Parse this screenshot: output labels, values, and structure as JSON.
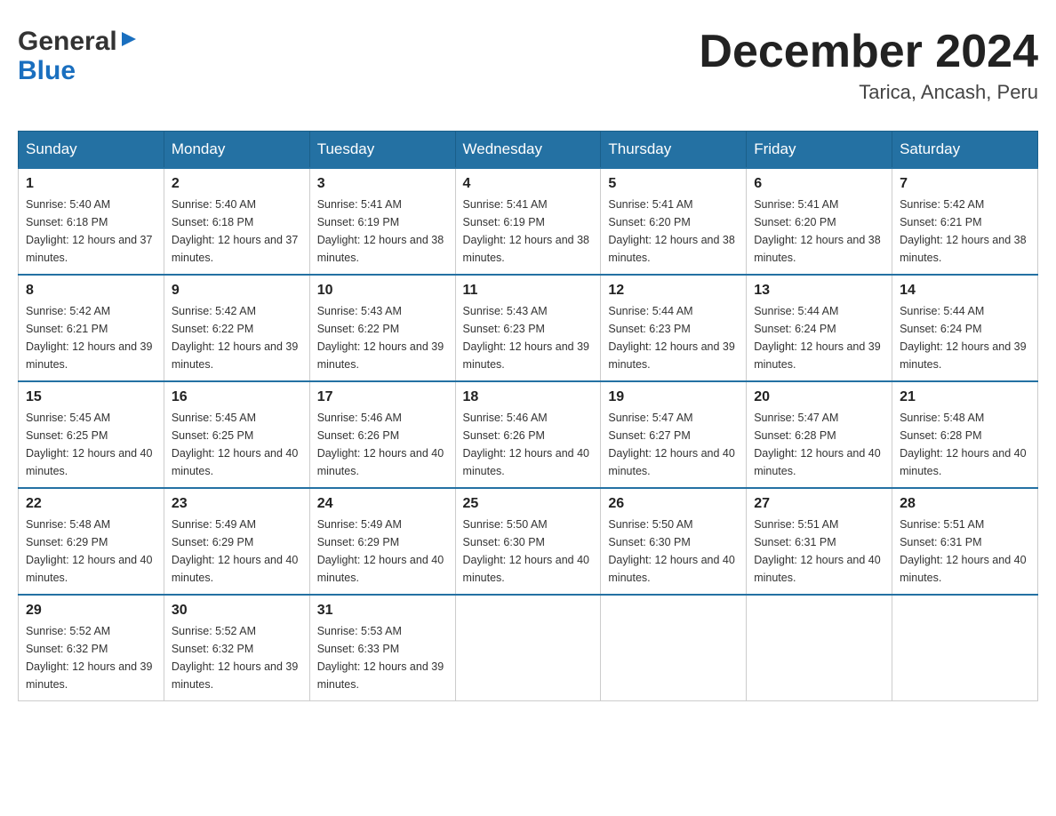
{
  "header": {
    "title": "December 2024",
    "location": "Tarica, Ancash, Peru",
    "logo_general": "General",
    "logo_blue": "Blue"
  },
  "calendar": {
    "days_of_week": [
      "Sunday",
      "Monday",
      "Tuesday",
      "Wednesday",
      "Thursday",
      "Friday",
      "Saturday"
    ],
    "weeks": [
      [
        {
          "day": "1",
          "sunrise": "Sunrise: 5:40 AM",
          "sunset": "Sunset: 6:18 PM",
          "daylight": "Daylight: 12 hours and 37 minutes."
        },
        {
          "day": "2",
          "sunrise": "Sunrise: 5:40 AM",
          "sunset": "Sunset: 6:18 PM",
          "daylight": "Daylight: 12 hours and 37 minutes."
        },
        {
          "day": "3",
          "sunrise": "Sunrise: 5:41 AM",
          "sunset": "Sunset: 6:19 PM",
          "daylight": "Daylight: 12 hours and 38 minutes."
        },
        {
          "day": "4",
          "sunrise": "Sunrise: 5:41 AM",
          "sunset": "Sunset: 6:19 PM",
          "daylight": "Daylight: 12 hours and 38 minutes."
        },
        {
          "day": "5",
          "sunrise": "Sunrise: 5:41 AM",
          "sunset": "Sunset: 6:20 PM",
          "daylight": "Daylight: 12 hours and 38 minutes."
        },
        {
          "day": "6",
          "sunrise": "Sunrise: 5:41 AM",
          "sunset": "Sunset: 6:20 PM",
          "daylight": "Daylight: 12 hours and 38 minutes."
        },
        {
          "day": "7",
          "sunrise": "Sunrise: 5:42 AM",
          "sunset": "Sunset: 6:21 PM",
          "daylight": "Daylight: 12 hours and 38 minutes."
        }
      ],
      [
        {
          "day": "8",
          "sunrise": "Sunrise: 5:42 AM",
          "sunset": "Sunset: 6:21 PM",
          "daylight": "Daylight: 12 hours and 39 minutes."
        },
        {
          "day": "9",
          "sunrise": "Sunrise: 5:42 AM",
          "sunset": "Sunset: 6:22 PM",
          "daylight": "Daylight: 12 hours and 39 minutes."
        },
        {
          "day": "10",
          "sunrise": "Sunrise: 5:43 AM",
          "sunset": "Sunset: 6:22 PM",
          "daylight": "Daylight: 12 hours and 39 minutes."
        },
        {
          "day": "11",
          "sunrise": "Sunrise: 5:43 AM",
          "sunset": "Sunset: 6:23 PM",
          "daylight": "Daylight: 12 hours and 39 minutes."
        },
        {
          "day": "12",
          "sunrise": "Sunrise: 5:44 AM",
          "sunset": "Sunset: 6:23 PM",
          "daylight": "Daylight: 12 hours and 39 minutes."
        },
        {
          "day": "13",
          "sunrise": "Sunrise: 5:44 AM",
          "sunset": "Sunset: 6:24 PM",
          "daylight": "Daylight: 12 hours and 39 minutes."
        },
        {
          "day": "14",
          "sunrise": "Sunrise: 5:44 AM",
          "sunset": "Sunset: 6:24 PM",
          "daylight": "Daylight: 12 hours and 39 minutes."
        }
      ],
      [
        {
          "day": "15",
          "sunrise": "Sunrise: 5:45 AM",
          "sunset": "Sunset: 6:25 PM",
          "daylight": "Daylight: 12 hours and 40 minutes."
        },
        {
          "day": "16",
          "sunrise": "Sunrise: 5:45 AM",
          "sunset": "Sunset: 6:25 PM",
          "daylight": "Daylight: 12 hours and 40 minutes."
        },
        {
          "day": "17",
          "sunrise": "Sunrise: 5:46 AM",
          "sunset": "Sunset: 6:26 PM",
          "daylight": "Daylight: 12 hours and 40 minutes."
        },
        {
          "day": "18",
          "sunrise": "Sunrise: 5:46 AM",
          "sunset": "Sunset: 6:26 PM",
          "daylight": "Daylight: 12 hours and 40 minutes."
        },
        {
          "day": "19",
          "sunrise": "Sunrise: 5:47 AM",
          "sunset": "Sunset: 6:27 PM",
          "daylight": "Daylight: 12 hours and 40 minutes."
        },
        {
          "day": "20",
          "sunrise": "Sunrise: 5:47 AM",
          "sunset": "Sunset: 6:28 PM",
          "daylight": "Daylight: 12 hours and 40 minutes."
        },
        {
          "day": "21",
          "sunrise": "Sunrise: 5:48 AM",
          "sunset": "Sunset: 6:28 PM",
          "daylight": "Daylight: 12 hours and 40 minutes."
        }
      ],
      [
        {
          "day": "22",
          "sunrise": "Sunrise: 5:48 AM",
          "sunset": "Sunset: 6:29 PM",
          "daylight": "Daylight: 12 hours and 40 minutes."
        },
        {
          "day": "23",
          "sunrise": "Sunrise: 5:49 AM",
          "sunset": "Sunset: 6:29 PM",
          "daylight": "Daylight: 12 hours and 40 minutes."
        },
        {
          "day": "24",
          "sunrise": "Sunrise: 5:49 AM",
          "sunset": "Sunset: 6:29 PM",
          "daylight": "Daylight: 12 hours and 40 minutes."
        },
        {
          "day": "25",
          "sunrise": "Sunrise: 5:50 AM",
          "sunset": "Sunset: 6:30 PM",
          "daylight": "Daylight: 12 hours and 40 minutes."
        },
        {
          "day": "26",
          "sunrise": "Sunrise: 5:50 AM",
          "sunset": "Sunset: 6:30 PM",
          "daylight": "Daylight: 12 hours and 40 minutes."
        },
        {
          "day": "27",
          "sunrise": "Sunrise: 5:51 AM",
          "sunset": "Sunset: 6:31 PM",
          "daylight": "Daylight: 12 hours and 40 minutes."
        },
        {
          "day": "28",
          "sunrise": "Sunrise: 5:51 AM",
          "sunset": "Sunset: 6:31 PM",
          "daylight": "Daylight: 12 hours and 40 minutes."
        }
      ],
      [
        {
          "day": "29",
          "sunrise": "Sunrise: 5:52 AM",
          "sunset": "Sunset: 6:32 PM",
          "daylight": "Daylight: 12 hours and 39 minutes."
        },
        {
          "day": "30",
          "sunrise": "Sunrise: 5:52 AM",
          "sunset": "Sunset: 6:32 PM",
          "daylight": "Daylight: 12 hours and 39 minutes."
        },
        {
          "day": "31",
          "sunrise": "Sunrise: 5:53 AM",
          "sunset": "Sunset: 6:33 PM",
          "daylight": "Daylight: 12 hours and 39 minutes."
        },
        null,
        null,
        null,
        null
      ]
    ]
  }
}
